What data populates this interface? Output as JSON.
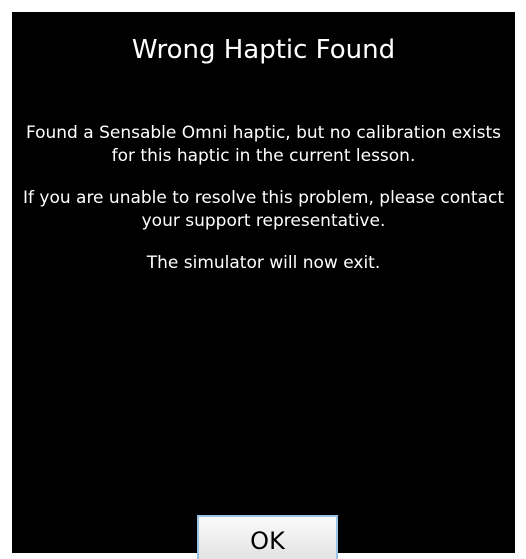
{
  "dialog": {
    "title": "Wrong Haptic Found",
    "message_lines": [
      "Found a Sensable Omni haptic, but no calibration exists for this haptic in the current lesson.",
      "If you are unable to resolve this problem, please contact your support representative.",
      "The simulator will now exit."
    ],
    "ok_label": "OK"
  },
  "colors": {
    "background": "#000000",
    "text": "#ffffff",
    "button_border": "#9bc3e6"
  }
}
